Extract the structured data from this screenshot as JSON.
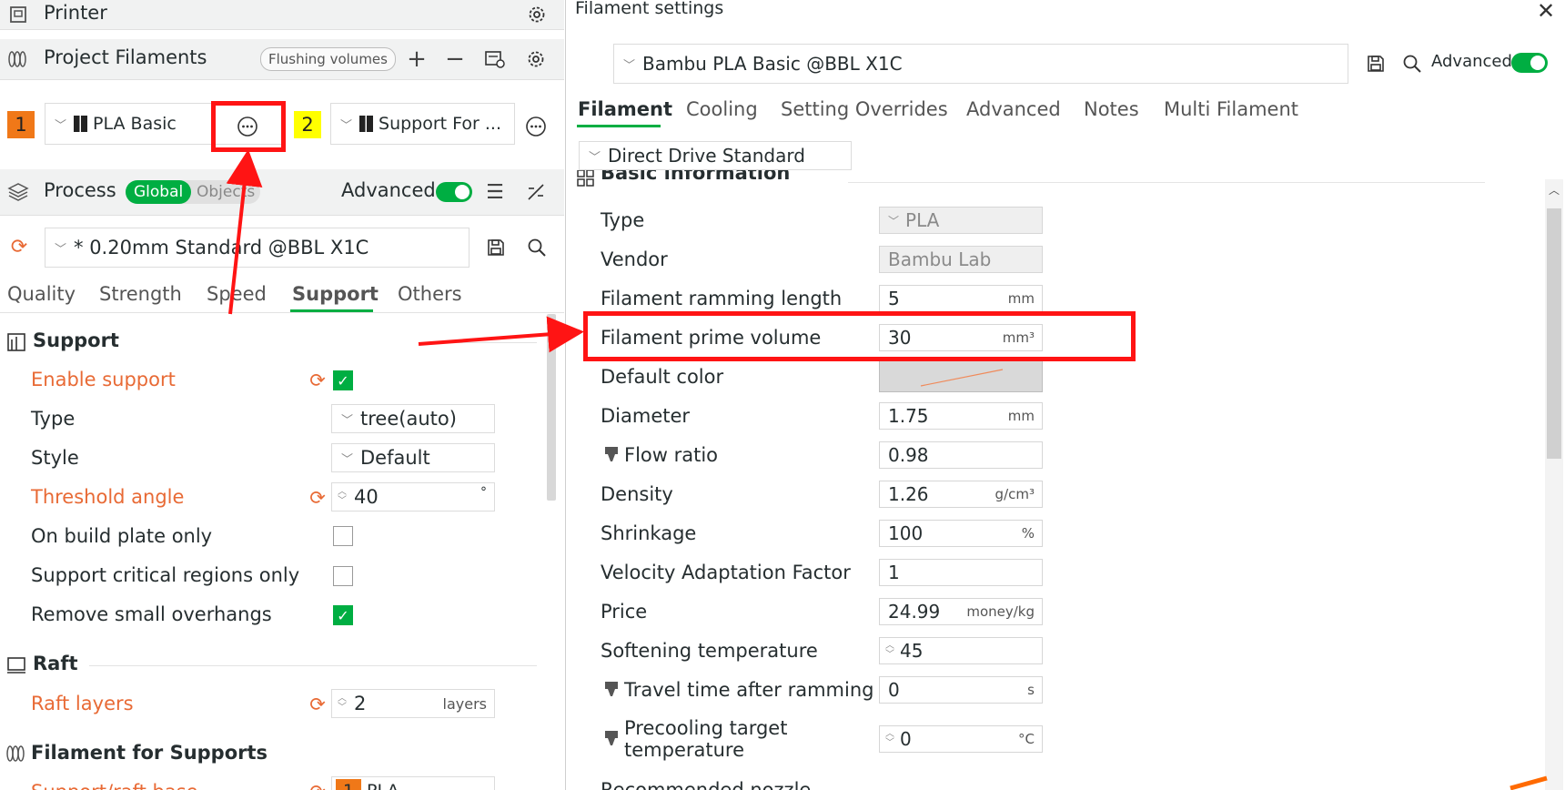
{
  "printer": {
    "title": "Printer"
  },
  "project_filaments": {
    "title": "Project Filaments",
    "flushing_button": "Flushing volumes",
    "slots": [
      {
        "index": "1",
        "name": "PLA Basic",
        "color": "#f07818"
      },
      {
        "index": "2",
        "name": "Support For ...",
        "color": "#ffff00"
      }
    ]
  },
  "process": {
    "title": "Process",
    "global_label": "Global",
    "objects_label": "Objects",
    "advanced_label": "Advanced",
    "preset": "* 0.20mm Standard @BBL X1C",
    "tabs": [
      "Quality",
      "Strength",
      "Speed",
      "Support",
      "Others"
    ],
    "active_tab": "Support"
  },
  "support_section": {
    "title": "Support",
    "rows": [
      {
        "label": "Enable support",
        "modified": true,
        "kind": "checkbox",
        "checked": true
      },
      {
        "label": "Type",
        "modified": false,
        "kind": "combo",
        "value": "tree(auto)"
      },
      {
        "label": "Style",
        "modified": false,
        "kind": "combo",
        "value": "Default"
      },
      {
        "label": "Threshold angle",
        "modified": true,
        "kind": "spin",
        "value": "40",
        "unit": "°"
      },
      {
        "label": "On build plate only",
        "modified": false,
        "kind": "checkbox",
        "checked": false
      },
      {
        "label": "Support critical regions only",
        "modified": false,
        "kind": "checkbox",
        "checked": false
      },
      {
        "label": "Remove small overhangs",
        "modified": false,
        "kind": "checkbox",
        "checked": true
      }
    ]
  },
  "raft_section": {
    "title": "Raft",
    "rows": [
      {
        "label": "Raft layers",
        "value": "2",
        "unit": "layers"
      }
    ]
  },
  "filament_supports_section": {
    "title": "Filament for Supports",
    "partial_row_label": "Support/raft base",
    "partial_row_value": "PLA",
    "partial_row_index": "1"
  },
  "filament_settings": {
    "window_title": "Filament settings",
    "preset": "Bambu PLA Basic @BBL X1C",
    "advanced_label": "Advanced",
    "tabs": [
      "Filament",
      "Cooling",
      "Setting Overrides",
      "Advanced",
      "Notes",
      "Multi Filament"
    ],
    "active_tab": "Filament",
    "extruder_variant": "Direct Drive Standard",
    "section_title": "Basic information",
    "rows": [
      {
        "label": "Type",
        "value": "PLA",
        "unit": "",
        "kind": "combo-ro"
      },
      {
        "label": "Vendor",
        "value": "Bambu Lab",
        "unit": "",
        "kind": "ro"
      },
      {
        "label": "Filament ramming length",
        "value": "5",
        "unit": "mm",
        "kind": "text"
      },
      {
        "label": "Filament prime volume",
        "value": "30",
        "unit": "mm³",
        "kind": "text"
      },
      {
        "label": "Default color",
        "value": "",
        "unit": "",
        "kind": "color"
      },
      {
        "label": "Diameter",
        "value": "1.75",
        "unit": "mm",
        "kind": "text"
      },
      {
        "label": "Flow ratio",
        "value": "0.98",
        "unit": "",
        "kind": "text",
        "icon": true
      },
      {
        "label": "Density",
        "value": "1.26",
        "unit": "g/cm³",
        "kind": "text"
      },
      {
        "label": "Shrinkage",
        "value": "100",
        "unit": "%",
        "kind": "text"
      },
      {
        "label": "Velocity Adaptation Factor",
        "value": "1",
        "unit": "",
        "kind": "text"
      },
      {
        "label": "Price",
        "value": "24.99",
        "unit": "money/kg",
        "kind": "text"
      },
      {
        "label": "Softening temperature",
        "value": "45",
        "unit": "",
        "kind": "spin"
      },
      {
        "label": "Travel time after ramming",
        "value": "0",
        "unit": "s",
        "kind": "text",
        "icon": true
      },
      {
        "label": "Precooling target temperature",
        "value": "0",
        "unit": "°C",
        "kind": "spin",
        "icon": true
      }
    ],
    "partial_next_label": "Recommended nozzle"
  },
  "colors": {
    "accent_green": "#00ae42",
    "modified_orange": "#e86a35",
    "annotation_red": "#ff1414"
  }
}
